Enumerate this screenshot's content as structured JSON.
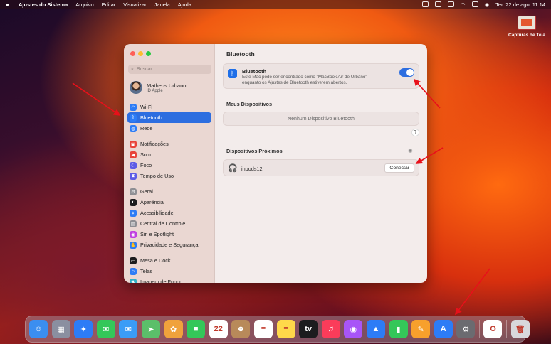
{
  "menubar": {
    "app": "Ajustes do Sistema",
    "menus": [
      "Arquivo",
      "Editar",
      "Visualizar",
      "Janela",
      "Ajuda"
    ],
    "datetime": "Ter. 22 de ago.  11:14"
  },
  "desktop": {
    "icon_label": "Capturas de Tela"
  },
  "sidebar": {
    "search_placeholder": "Buscar",
    "user": {
      "name": "Matheus Urbano",
      "subtitle": "ID Apple"
    },
    "items": [
      {
        "label": "Wi-Fi",
        "icon": "wifi-icon",
        "color": "#2d7cf6"
      },
      {
        "label": "Bluetooth",
        "icon": "bluetooth-icon",
        "color": "#2d7cf6",
        "selected": true
      },
      {
        "label": "Rede",
        "icon": "globe-icon",
        "color": "#2d7cf6"
      },
      {
        "label": "Notificações",
        "icon": "bell-icon",
        "color": "#e8443a"
      },
      {
        "label": "Som",
        "icon": "speaker-icon",
        "color": "#e8443a"
      },
      {
        "label": "Foco",
        "icon": "moon-icon",
        "color": "#5e5ce6"
      },
      {
        "label": "Tempo de Uso",
        "icon": "hourglass-icon",
        "color": "#5e5ce6"
      },
      {
        "label": "Geral",
        "icon": "gear-icon",
        "color": "#8e8e93"
      },
      {
        "label": "Aparência",
        "icon": "appearance-icon",
        "color": "#1c1c1e"
      },
      {
        "label": "Acessibilidade",
        "icon": "accessibility-icon",
        "color": "#2d7cf6"
      },
      {
        "label": "Central de Controle",
        "icon": "control-center-icon",
        "color": "#8e8e93"
      },
      {
        "label": "Siri e Spotlight",
        "icon": "siri-icon",
        "color": "#c03fe0"
      },
      {
        "label": "Privacidade e Segurança",
        "icon": "hand-icon",
        "color": "#2d7cf6"
      },
      {
        "label": "Mesa e Dock",
        "icon": "dock-icon",
        "color": "#1c1c1e"
      },
      {
        "label": "Telas",
        "icon": "display-icon",
        "color": "#2d7cf6"
      },
      {
        "label": "Imagem de Fundo",
        "icon": "wallpaper-icon",
        "color": "#30b0c7"
      }
    ]
  },
  "main": {
    "title": "Bluetooth",
    "bluetooth": {
      "label": "Bluetooth",
      "description": "Este Mac pode ser encontrado como \"MacBook Air de Urbano\" enquanto os Ajustes de Bluetooth estiverem abertos.",
      "enabled": true
    },
    "my_devices": {
      "heading": "Meus Dispositivos",
      "empty": "Nenhum Dispositivo Bluetooth"
    },
    "help": "?",
    "nearby": {
      "heading": "Dispositivos Próximos",
      "devices": [
        {
          "name": "inpods12",
          "action": "Conectar"
        }
      ]
    }
  },
  "dock": {
    "apps": [
      {
        "name": "finder",
        "color": "#3b8ef0",
        "glyph": "☺"
      },
      {
        "name": "launchpad",
        "color": "#8a8fa0",
        "glyph": "▦"
      },
      {
        "name": "safari",
        "color": "#2d7cf6",
        "glyph": "✦"
      },
      {
        "name": "messages",
        "color": "#34c759",
        "glyph": "✉"
      },
      {
        "name": "mail",
        "color": "#3a9cf6",
        "glyph": "✉"
      },
      {
        "name": "maps",
        "color": "#5bbf6a",
        "glyph": "➤"
      },
      {
        "name": "photos",
        "color": "#f0a23c",
        "glyph": "✿"
      },
      {
        "name": "facetime",
        "color": "#34c759",
        "glyph": "■"
      },
      {
        "name": "calendar",
        "color": "#ffffff",
        "glyph": "22"
      },
      {
        "name": "contacts",
        "color": "#b88a5a",
        "glyph": "☻"
      },
      {
        "name": "reminders",
        "color": "#ffffff",
        "glyph": "≡"
      },
      {
        "name": "notes",
        "color": "#ffd84a",
        "glyph": "≡"
      },
      {
        "name": "tv",
        "color": "#1c1c1e",
        "glyph": "tv"
      },
      {
        "name": "music",
        "color": "#fa3c5a",
        "glyph": "♫"
      },
      {
        "name": "podcasts",
        "color": "#a855f7",
        "glyph": "◉"
      },
      {
        "name": "keynote",
        "color": "#2d7cf6",
        "glyph": "▲"
      },
      {
        "name": "numbers",
        "color": "#34c759",
        "glyph": "▮"
      },
      {
        "name": "pages",
        "color": "#f7a02c",
        "glyph": "✎"
      },
      {
        "name": "app-store",
        "color": "#2d7cf6",
        "glyph": "A"
      },
      {
        "name": "system-settings",
        "color": "#6b6b70",
        "glyph": "⚙"
      },
      {
        "name": "opera",
        "color": "#ffffff",
        "glyph": "O"
      },
      {
        "name": "trash",
        "color": "#d8d8dc",
        "glyph": "🗑"
      }
    ]
  }
}
